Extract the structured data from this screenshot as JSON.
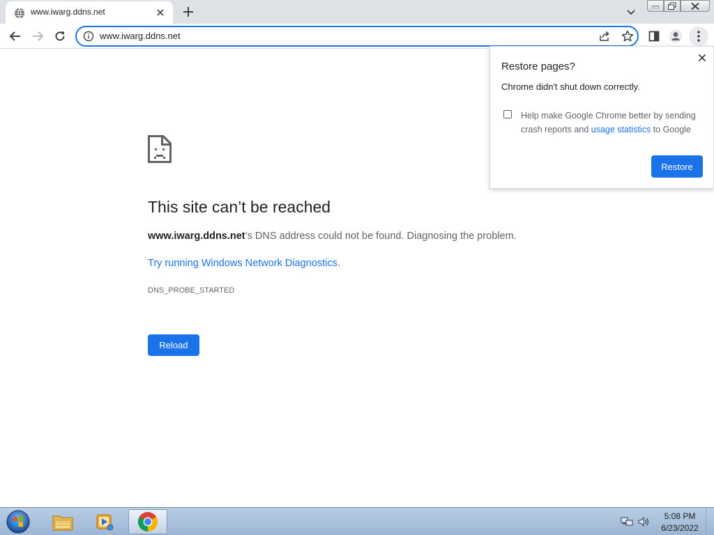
{
  "tab": {
    "title": "www.iwarg.ddns.net",
    "favicon": "globe-icon"
  },
  "omnibox": {
    "url": "www.iwarg.ddns.net",
    "info_icon": "info-icon"
  },
  "error_page": {
    "title": "This site can’t be reached",
    "host": "www.iwarg.ddns.net",
    "description": "’s DNS address could not be found. Diagnosing the problem.",
    "diagnostics_link": "Try running Windows Network Diagnostics",
    "diagnostics_suffix": ".",
    "error_code": "DNS_PROBE_STARTED",
    "reload_label": "Reload"
  },
  "restore_bubble": {
    "title": "Restore pages?",
    "message": "Chrome didn't shut down correctly.",
    "checkbox_text_before": "Help make Google Chrome better by sending crash reports and ",
    "checkbox_link": "usage statistics",
    "checkbox_text_after": " to Google",
    "checkbox_checked": false,
    "restore_label": "Restore"
  },
  "taskbar": {
    "time": "5:08 PM",
    "date": "6/23/2022",
    "apps": [
      "explorer-icon",
      "media-player-icon",
      "chrome-icon"
    ]
  },
  "colors": {
    "accent": "#1a73e8",
    "tabstrip": "#dee1e6",
    "text_primary": "#202124",
    "text_secondary": "#5f6368"
  }
}
